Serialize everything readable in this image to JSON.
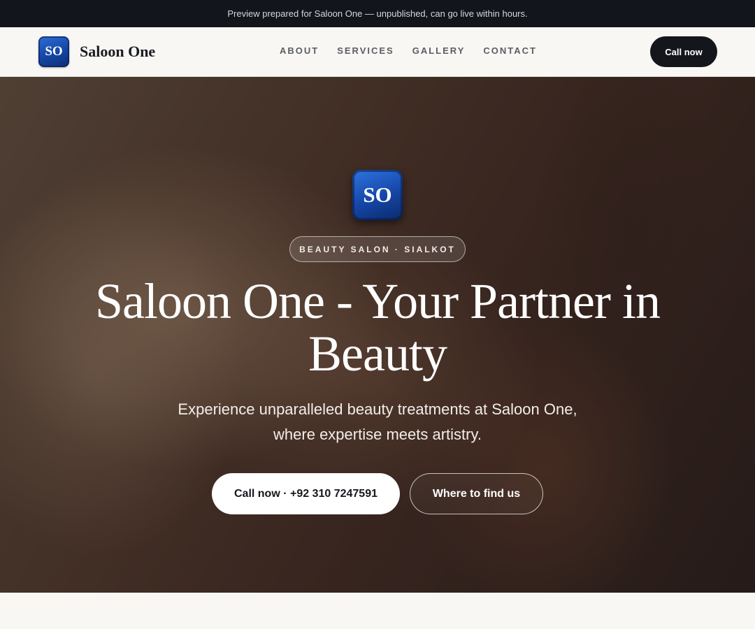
{
  "banner": {
    "text": "Preview prepared for Saloon One — unpublished, can go live within hours."
  },
  "header": {
    "logo_text": "SO",
    "brand_name": "Saloon One",
    "nav": [
      {
        "label": "ABOUT"
      },
      {
        "label": "SERVICES"
      },
      {
        "label": "GALLERY"
      },
      {
        "label": "CONTACT"
      }
    ],
    "cta_label": "Call now"
  },
  "hero": {
    "logo_text": "SO",
    "tag": "BEAUTY SALON · SIALKOT",
    "title": "Saloon One - Your Partner in Beauty",
    "subtitle": "Experience unparalleled beauty treatments at Saloon One, where expertise meets artistry.",
    "primary_button": "Call now · +92 310 7247591",
    "secondary_button": "Where to find us"
  },
  "colors": {
    "banner_bg": "#12151b",
    "logo_blue": "#1545a3",
    "dark_button": "#14161c",
    "page_bg": "#f8f7f4"
  }
}
